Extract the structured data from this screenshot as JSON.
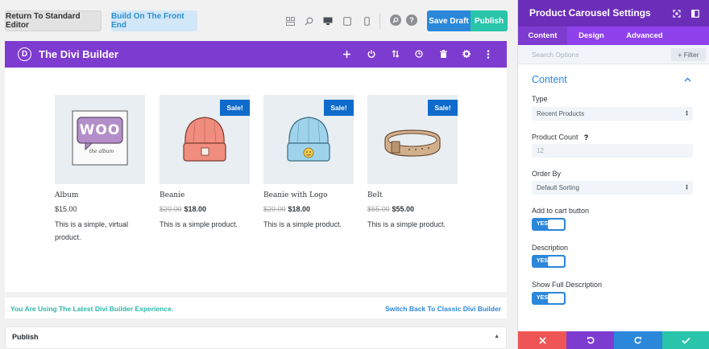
{
  "topbar": {
    "return_label": "Return To Standard Editor",
    "frontend_label": "Build On The Front End",
    "save_draft_label": "Save Draft",
    "publish_label": "Publish"
  },
  "divi": {
    "logo_letter": "D",
    "title": "The Divi Builder"
  },
  "products": [
    {
      "name": "Album",
      "old_price": "",
      "price": "$15.00",
      "desc": "This is a simple, virtual product.",
      "sale": ""
    },
    {
      "name": "Beanie",
      "old_price": "$20.00",
      "price": "$18.00",
      "desc": "This is a simple product.",
      "sale": "Sale!"
    },
    {
      "name": "Beanie with Logo",
      "old_price": "$20.00",
      "price": "$18.00",
      "desc": "This is a simple product.",
      "sale": "Sale!"
    },
    {
      "name": "Belt",
      "old_price": "$65.00",
      "price": "$55.00",
      "desc": "This is a simple product.",
      "sale": "Sale!"
    }
  ],
  "album_art": {
    "logo_text": "WOO",
    "caption": "the album"
  },
  "notice": {
    "left": "You Are Using The Latest Divi Builder Experience.",
    "right": "Switch Back To Classic Divi Builder"
  },
  "publish_box": {
    "title": "Publish"
  },
  "panel": {
    "title": "Product Carousel Settings",
    "tabs": [
      "Content",
      "Design",
      "Advanced"
    ],
    "search_placeholder": "Search Options",
    "filter_label": "+ Filter",
    "section_title": "Content",
    "type_label": "Type",
    "type_value": "Recent Products",
    "count_label": "Product Count",
    "count_help": "?",
    "count_value": "12",
    "order_label": "Order By",
    "order_value": "Default Sorting",
    "cart_label": "Add to cart button",
    "desc_label": "Description",
    "full_desc_label": "Show Full Description",
    "toggle_yes": "YES"
  },
  "colors": {
    "divi_purple": "#7e3bd0",
    "panel_purple": "#6c2eb9",
    "blue": "#2b87da",
    "teal": "#29c4a9",
    "red": "#ef5555",
    "sale_blue": "#0f6bcb"
  }
}
